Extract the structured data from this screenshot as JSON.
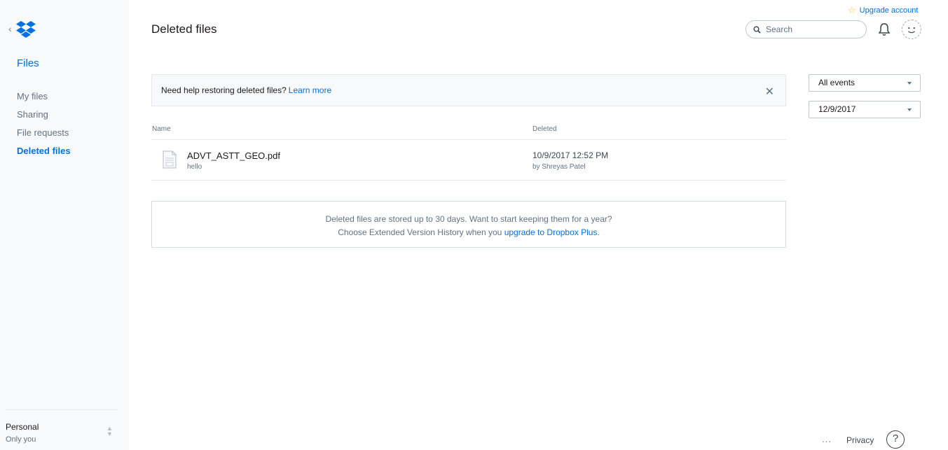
{
  "sidebar": {
    "section_title": "Files",
    "items": [
      {
        "label": "My files"
      },
      {
        "label": "Sharing"
      },
      {
        "label": "File requests"
      },
      {
        "label": "Deleted files",
        "active": true
      }
    ],
    "account": {
      "name": "Personal",
      "subtitle": "Only you"
    }
  },
  "header": {
    "title": "Deleted files",
    "upgrade_label": "Upgrade account",
    "search_placeholder": "Search"
  },
  "banner": {
    "text": "Need help restoring deleted files?",
    "link": "Learn more"
  },
  "table": {
    "columns": [
      "Name",
      "Deleted"
    ],
    "rows": [
      {
        "name": "ADVT_ASTT_GEO.pdf",
        "subtitle": "hello",
        "deleted_at": "10/9/2017 12:52 PM",
        "deleted_by": "by Shreyas Patel"
      }
    ]
  },
  "info": {
    "line1": "Deleted files are stored up to 30 days. Want to start keeping them for a year?",
    "line2_prefix": "Choose Extended Version History when you",
    "line2_link": "upgrade to Dropbox Plus."
  },
  "filters": {
    "events": "All events",
    "date": "12/9/2017"
  },
  "footer": {
    "more": "...",
    "privacy": "Privacy",
    "help": "?"
  },
  "colors": {
    "accent": "#0070e0",
    "sidebar_bg": "#f7f9fa",
    "star": "#f0c040"
  }
}
